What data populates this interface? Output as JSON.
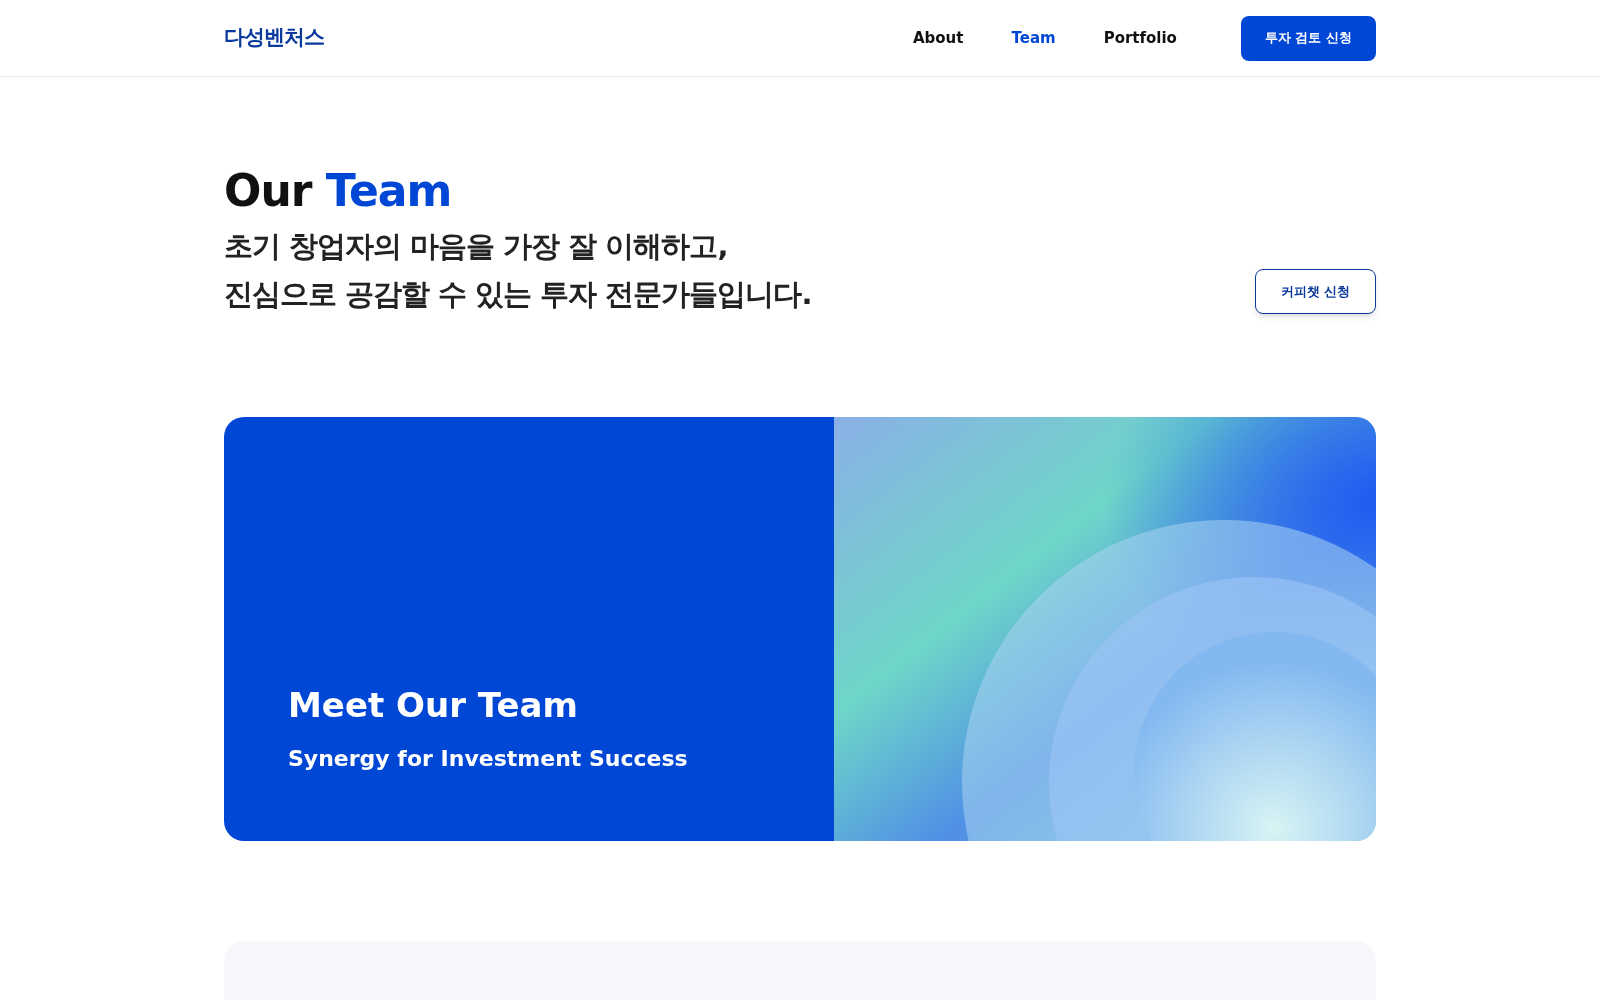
{
  "header": {
    "logo": "다성벤처스",
    "nav": [
      {
        "label": "About",
        "selected": false
      },
      {
        "label": "Team",
        "selected": true
      },
      {
        "label": "Portfolio",
        "selected": false
      }
    ],
    "cta": "투자 검토 신청"
  },
  "intro": {
    "title_prefix": "Our",
    "title_highlight": "Team",
    "subtitle_lines": [
      "초기 창업자의 마음을 가장 잘 이해하고,",
      "진심으로 공감할 수 있는 투자 전문가들입니다."
    ],
    "button": "커피챗 신청"
  },
  "banner": {
    "title": "Meet Our Team",
    "subtitle": "Synergy for Investment Success"
  }
}
